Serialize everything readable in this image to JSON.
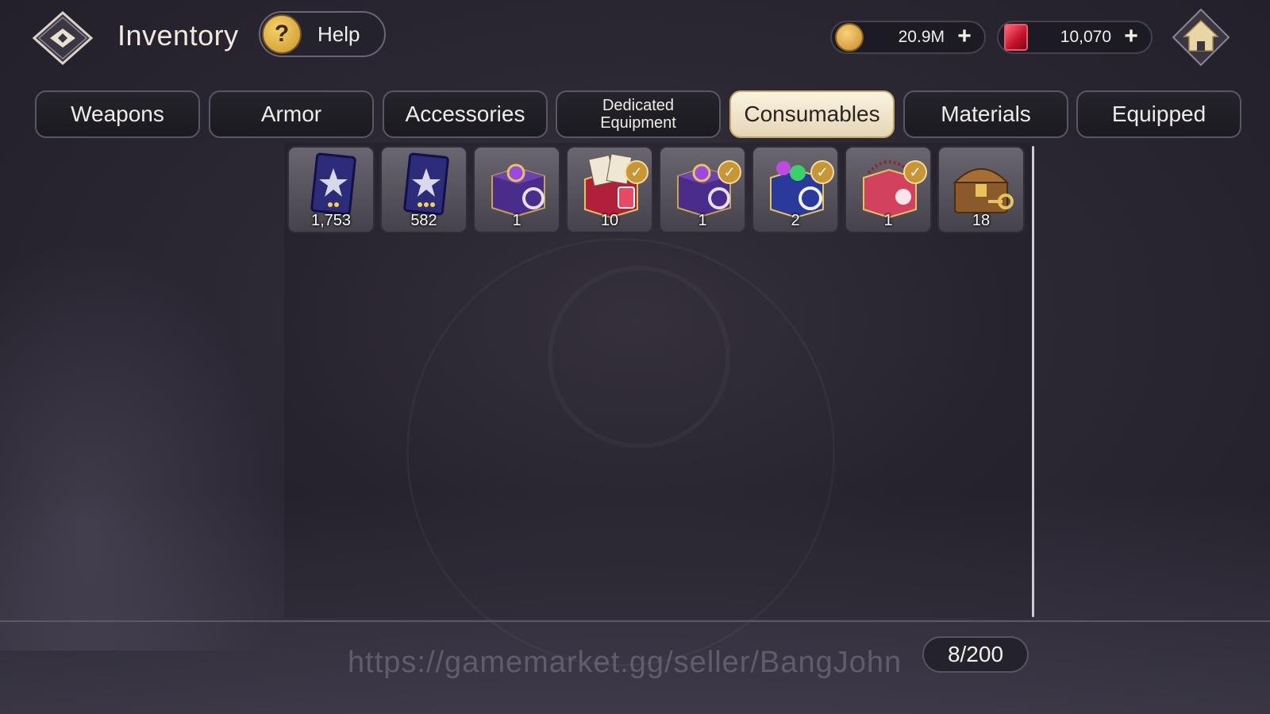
{
  "header": {
    "title": "Inventory",
    "help_label": "Help",
    "help_symbol": "?",
    "back_icon": "compass-back-icon",
    "home_icon": "home-icon"
  },
  "currencies": {
    "gold": {
      "amount": "20.9M",
      "icon": "gold-coin-icon",
      "plus": "+"
    },
    "gem": {
      "amount": "10,070",
      "icon": "red-gem-icon",
      "plus": "+"
    }
  },
  "tabs": [
    {
      "label": "Weapons",
      "active": false
    },
    {
      "label": "Armor",
      "active": false
    },
    {
      "label": "Accessories",
      "active": false
    },
    {
      "label": "Dedicated\nEquipment",
      "active": false
    },
    {
      "label": "Consumables",
      "active": true
    },
    {
      "label": "Materials",
      "active": false
    },
    {
      "label": "Equipped",
      "active": false
    }
  ],
  "items": [
    {
      "name": "2-star blue card",
      "count": "1,753",
      "checked": false
    },
    {
      "name": "3-star blue card",
      "count": "582",
      "checked": false
    },
    {
      "name": "purple ring box",
      "count": "1",
      "checked": false
    },
    {
      "name": "red card box",
      "count": "10",
      "checked": true
    },
    {
      "name": "purple ring box",
      "count": "1",
      "checked": true
    },
    {
      "name": "blue gem box",
      "count": "2",
      "checked": true
    },
    {
      "name": "red jewel box",
      "count": "1",
      "checked": true
    },
    {
      "name": "treasure chest with key",
      "count": "18",
      "checked": false
    }
  ],
  "footer": {
    "watermark": "https://gamemarket.gg/seller/BangJohn",
    "capacity": "8/200"
  },
  "colors": {
    "active_tab": "#f4ead2",
    "tab_border": "#5a5664",
    "accent_gold": "#c99636"
  }
}
